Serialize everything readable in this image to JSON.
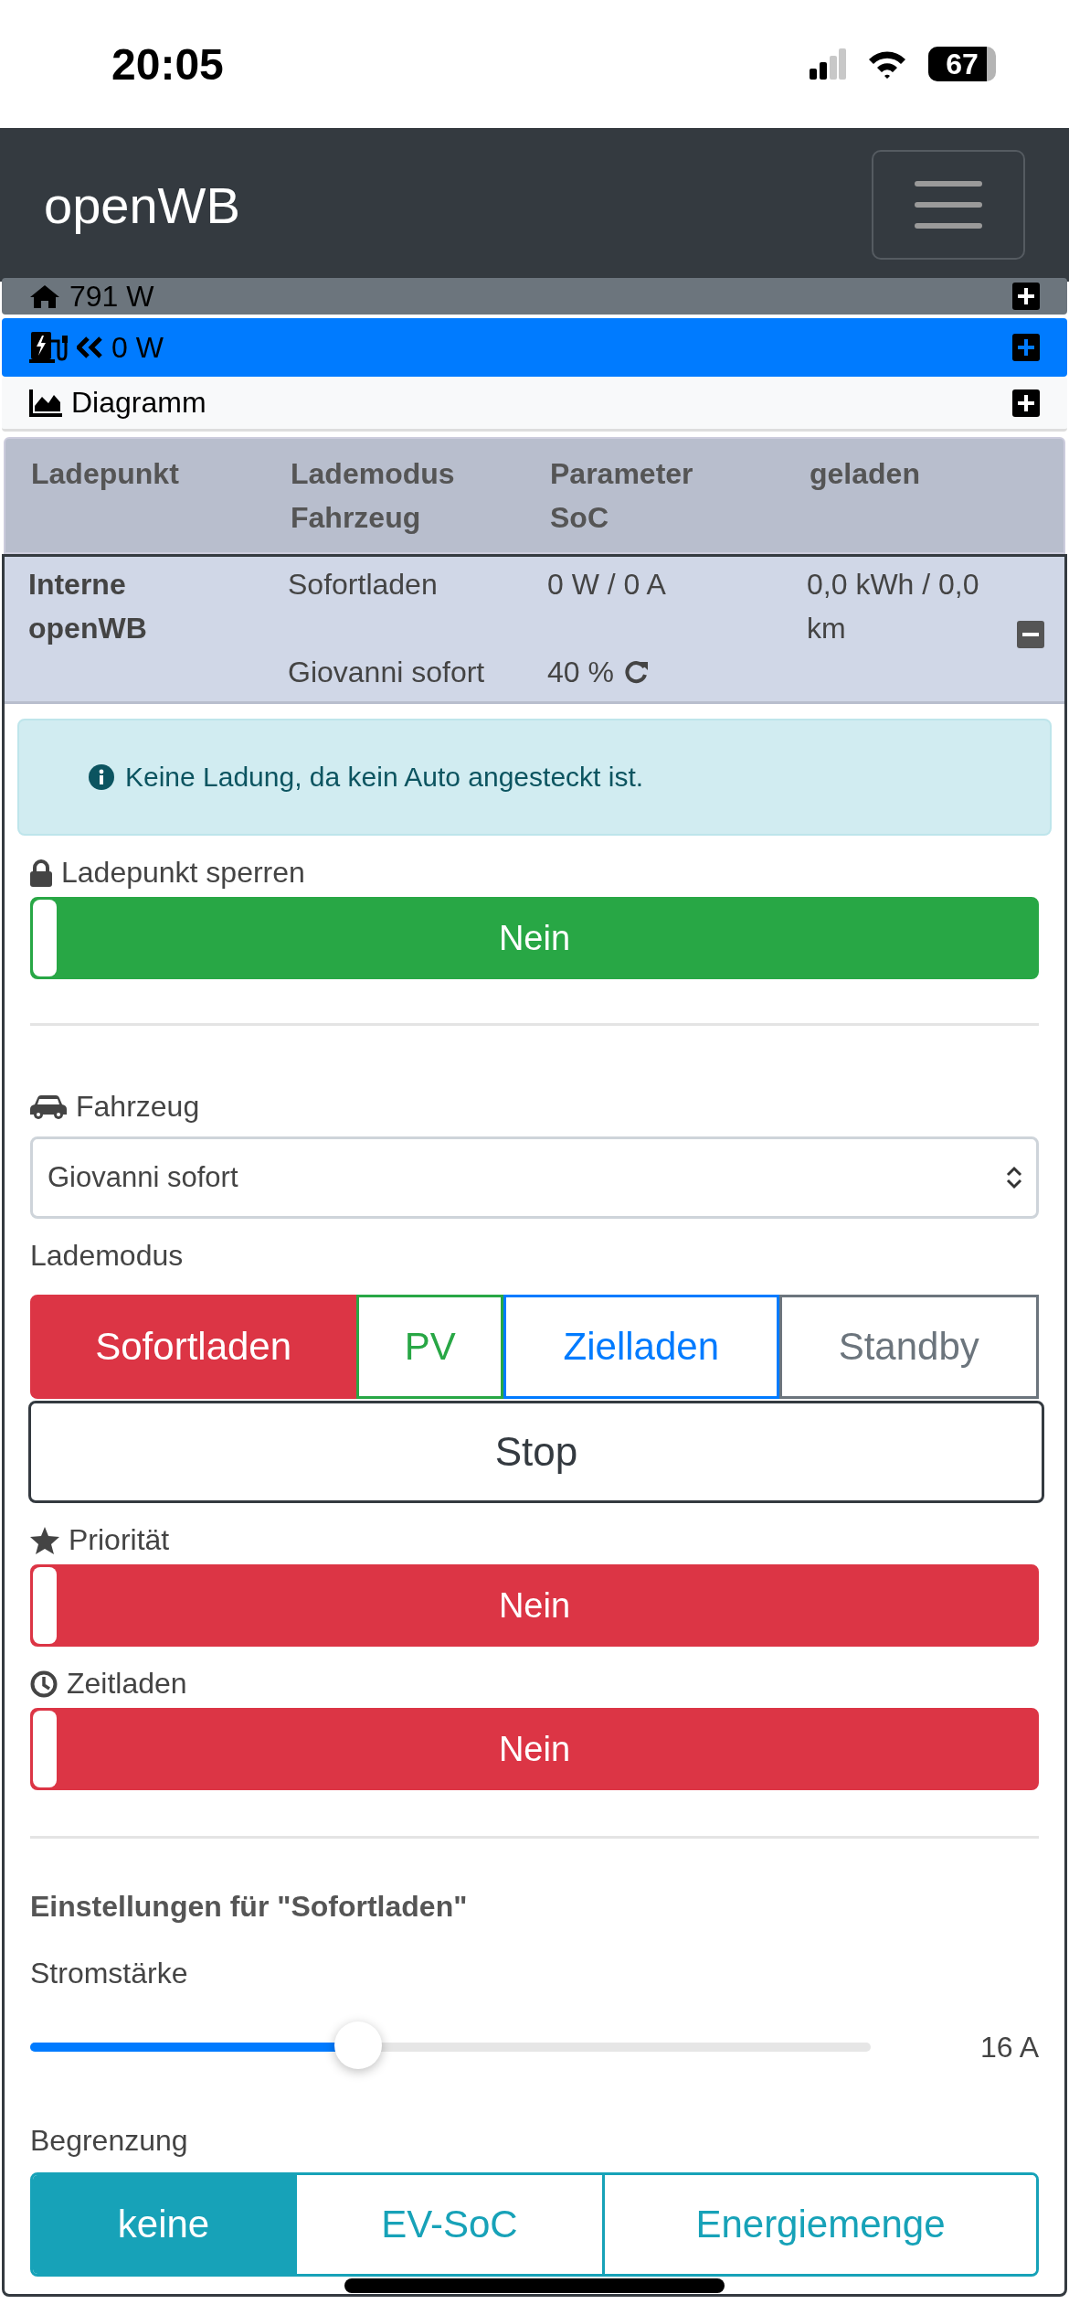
{
  "status_bar": {
    "time": "20:05",
    "battery": "67"
  },
  "navbar": {
    "brand": "openWB"
  },
  "summary_rows": [
    {
      "kind": "house",
      "text": "791 W",
      "color": "#6c757d",
      "expanded": false
    },
    {
      "kind": "charge",
      "text": "0 W",
      "color": "#007bff",
      "expanded": false
    },
    {
      "kind": "chart",
      "text": "Diagramm",
      "color": "#f8f9fa",
      "expanded": false
    }
  ],
  "table": {
    "columns": [
      {
        "lines": [
          "Ladepunkt"
        ]
      },
      {
        "lines": [
          "Lademodus",
          "Fahrzeug"
        ]
      },
      {
        "lines": [
          "Parameter",
          "SoC"
        ]
      },
      {
        "lines": [
          "geladen"
        ]
      }
    ],
    "rows": [
      {
        "expanded": true,
        "name": "Interne openWB",
        "mode": "Sofortladen",
        "power": "0 W / 0 A",
        "charged": "0,0 kWh / 0,0 km",
        "vehicle": "Giovanni sofort",
        "soc": "40 %"
      }
    ]
  },
  "alert": "Keine Ladung, da kein Auto angesteckt ist.",
  "lock_toggle": {
    "kind": "lock",
    "label": "Ladepunkt sperren",
    "on": false,
    "value": "Nein",
    "color": "#28a745"
  },
  "vehicle": {
    "label": "Fahrzeug",
    "value": "Giovanni sofort"
  },
  "charge_mode": {
    "label": "Lademodus",
    "options": [
      {
        "label": "Sofortladen",
        "selected": true,
        "color": "#dc3545"
      },
      {
        "label": "PV",
        "selected": false,
        "color": "#28a745"
      },
      {
        "label": "Zielladen",
        "selected": false,
        "color": "#007bff"
      },
      {
        "label": "Standby",
        "selected": false,
        "color": "#6c757d"
      }
    ],
    "stop": "Stop"
  },
  "toggles": [
    {
      "kind": "star",
      "label": "Priorität",
      "on": false,
      "value": "Nein",
      "color": "#dc3545"
    },
    {
      "kind": "clock",
      "label": "Zeitladen",
      "on": false,
      "value": "Nein",
      "color": "#dc3545"
    }
  ],
  "settings": {
    "title": "Einstellungen für \"Sofortladen\"",
    "current": {
      "label": "Stromstärke",
      "level": 0.39,
      "reading": "16 A"
    },
    "limit": {
      "label": "Begrenzung",
      "options": [
        {
          "label": "keine",
          "selected": true
        },
        {
          "label": "EV-SoC",
          "selected": false
        },
        {
          "label": "Energiemenge",
          "selected": false
        }
      ]
    }
  }
}
